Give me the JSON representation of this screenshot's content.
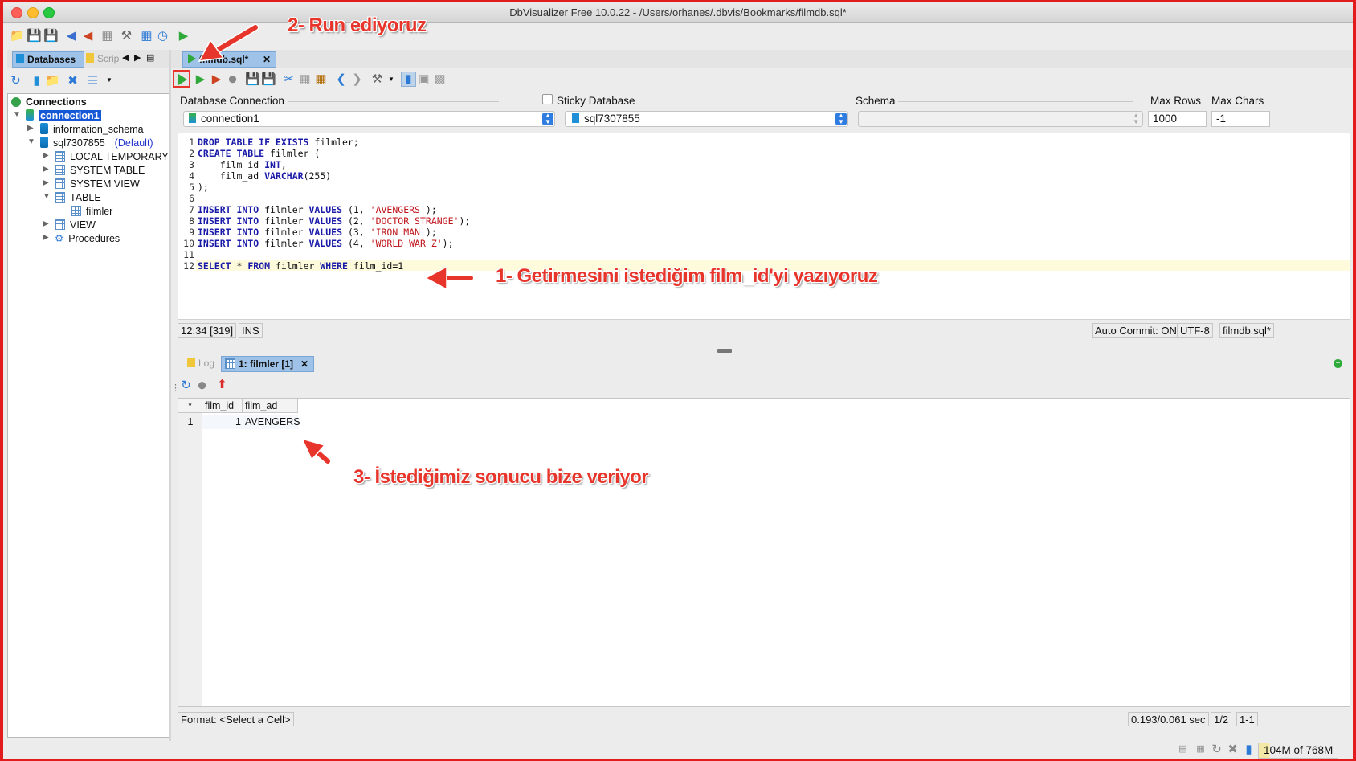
{
  "window": {
    "title": "DbVisualizer Free 10.0.22 - /Users/orhanes/.dbvis/Bookmarks/filmdb.sql*"
  },
  "left_tabs": {
    "databases": "Databases",
    "scripts": "Scrip"
  },
  "tree": {
    "root": "Connections",
    "connection": "connection1",
    "schema1": "information_schema",
    "schema2": "sql7307855",
    "schema2_default": "(Default)",
    "nodes": [
      "LOCAL TEMPORARY",
      "SYSTEM TABLE",
      "SYSTEM VIEW",
      "TABLE",
      "filmler",
      "VIEW",
      "Procedures"
    ]
  },
  "editor_tab": {
    "label": "filmdb.sql*"
  },
  "conn": {
    "db_conn_label": "Database Connection",
    "db_conn_value": "connection1",
    "sticky_label": "Sticky Database",
    "database_value": "sql7307855",
    "schema_label": "Schema",
    "schema_value": "",
    "max_rows_label": "Max Rows",
    "max_rows_value": "1000",
    "max_chars_label": "Max Chars",
    "max_chars_value": "-1"
  },
  "editor": {
    "line_numbers": [
      "1",
      "2",
      "3",
      "4",
      "5",
      "6",
      "7",
      "8",
      "9",
      "10",
      "11",
      "12"
    ],
    "lines": [
      [
        {
          "t": "DROP TABLE IF EXISTS",
          "k": "kw"
        },
        {
          "t": " filmler;",
          "k": ""
        }
      ],
      [
        {
          "t": "CREATE TABLE",
          "k": "kw"
        },
        {
          "t": " filmler (",
          "k": ""
        }
      ],
      [
        {
          "t": "    film_id ",
          "k": ""
        },
        {
          "t": "INT",
          "k": "kw"
        },
        {
          "t": ",",
          "k": ""
        }
      ],
      [
        {
          "t": "    film_ad ",
          "k": ""
        },
        {
          "t": "VARCHAR",
          "k": "kw"
        },
        {
          "t": "(255)",
          "k": ""
        }
      ],
      [
        {
          "t": ");",
          "k": ""
        }
      ],
      [
        {
          "t": "",
          "k": ""
        }
      ],
      [
        {
          "t": "INSERT INTO",
          "k": "kw"
        },
        {
          "t": " filmler ",
          "k": ""
        },
        {
          "t": "VALUES",
          "k": "kw"
        },
        {
          "t": " (1, ",
          "k": ""
        },
        {
          "t": "'AVENGERS'",
          "k": "str"
        },
        {
          "t": ");",
          "k": ""
        }
      ],
      [
        {
          "t": "INSERT INTO",
          "k": "kw"
        },
        {
          "t": " filmler ",
          "k": ""
        },
        {
          "t": "VALUES",
          "k": "kw"
        },
        {
          "t": " (2, ",
          "k": ""
        },
        {
          "t": "'DOCTOR STRANGE'",
          "k": "str"
        },
        {
          "t": ");",
          "k": ""
        }
      ],
      [
        {
          "t": "INSERT INTO",
          "k": "kw"
        },
        {
          "t": " filmler ",
          "k": ""
        },
        {
          "t": "VALUES",
          "k": "kw"
        },
        {
          "t": " (3, ",
          "k": ""
        },
        {
          "t": "'IRON MAN'",
          "k": "str"
        },
        {
          "t": ");",
          "k": ""
        }
      ],
      [
        {
          "t": "INSERT INTO",
          "k": "kw"
        },
        {
          "t": " filmler ",
          "k": ""
        },
        {
          "t": "VALUES",
          "k": "kw"
        },
        {
          "t": " (4, ",
          "k": ""
        },
        {
          "t": "'WORLD WAR Z'",
          "k": "str"
        },
        {
          "t": ");",
          "k": ""
        }
      ],
      [
        {
          "t": "",
          "k": ""
        }
      ],
      [
        {
          "t": "SELECT",
          "k": "kw"
        },
        {
          "t": " * ",
          "k": ""
        },
        {
          "t": "FROM",
          "k": "kw"
        },
        {
          "t": " filmler ",
          "k": ""
        },
        {
          "t": "WHERE",
          "k": "kw"
        },
        {
          "t": " film_id=1",
          "k": ""
        }
      ]
    ]
  },
  "status": {
    "position": "12:34 [319]",
    "mode": "INS",
    "auto_commit": "Auto Commit: ON",
    "encoding": "UTF-8",
    "file": "filmdb.sql*"
  },
  "results": {
    "log_tab": "Log",
    "result_tab": "1: filmler [1]",
    "corner": "*",
    "columns": [
      "film_id",
      "film_ad"
    ],
    "rows": [
      {
        "num": "1",
        "film_id": "1",
        "film_ad": "AVENGERS"
      }
    ],
    "format": "Format: <Select a Cell>",
    "timing": "0.193/0.061 sec",
    "page": "1/2",
    "range": "1-1"
  },
  "memory": "104M of 768M",
  "annotations": {
    "step1": "1- Getirmesini istediğim film_id'yi yazıyoruz",
    "step2": "2- Run ediyoruz",
    "step3": "3- İstediğimiz sonucu bize veriyor"
  },
  "colors": {
    "annotation": "#e8352b",
    "tab_selected": "#9fc3e8",
    "keyword": "#1a1aa8",
    "string": "#c0161d",
    "window_border": "#e21c1c"
  }
}
